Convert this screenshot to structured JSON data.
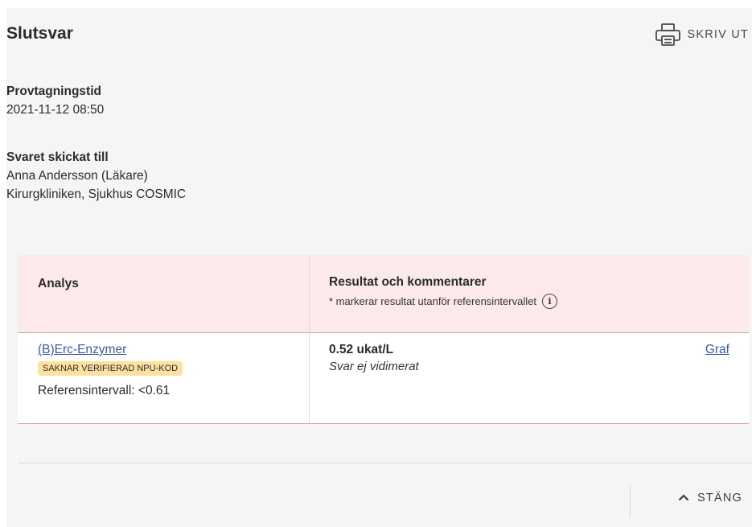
{
  "header": {
    "title": "Slutsvar",
    "print_label": "SKRIV UT"
  },
  "sampling": {
    "label": "Provtagningstid",
    "value": "2021-11-12 08:50"
  },
  "sent_to": {
    "label": "Svaret skickat till",
    "person": "Anna Andersson (Läkare)",
    "unit": "Kirurgkliniken, Sjukhus COSMIC"
  },
  "table": {
    "col_analysis": "Analys",
    "col_results": "Resultat och kommentarer",
    "col_results_note": "* markerar resultat utanför referensintervallet",
    "rows": [
      {
        "analysis": "(B)Erc-Enzymer",
        "badge": "SAKNAR VERIFIERAD NPU-KOD",
        "reference": "Referensintervall: <0.61",
        "result": "0.52 ukat/L",
        "status": "Svar ej vidimerat",
        "graph_link": "Graf"
      }
    ]
  },
  "footer": {
    "close_label": "STÄNG"
  },
  "colors": {
    "header_row_bg": "#fbe9ec",
    "row_border": "#d6a2ad",
    "badge_bg": "#fde1a0",
    "link": "#3a5ba6",
    "panel_bg": "#f5f5f5"
  },
  "icons": {
    "print": "printer-icon",
    "info": "info-icon",
    "close": "chevron-up-icon"
  }
}
